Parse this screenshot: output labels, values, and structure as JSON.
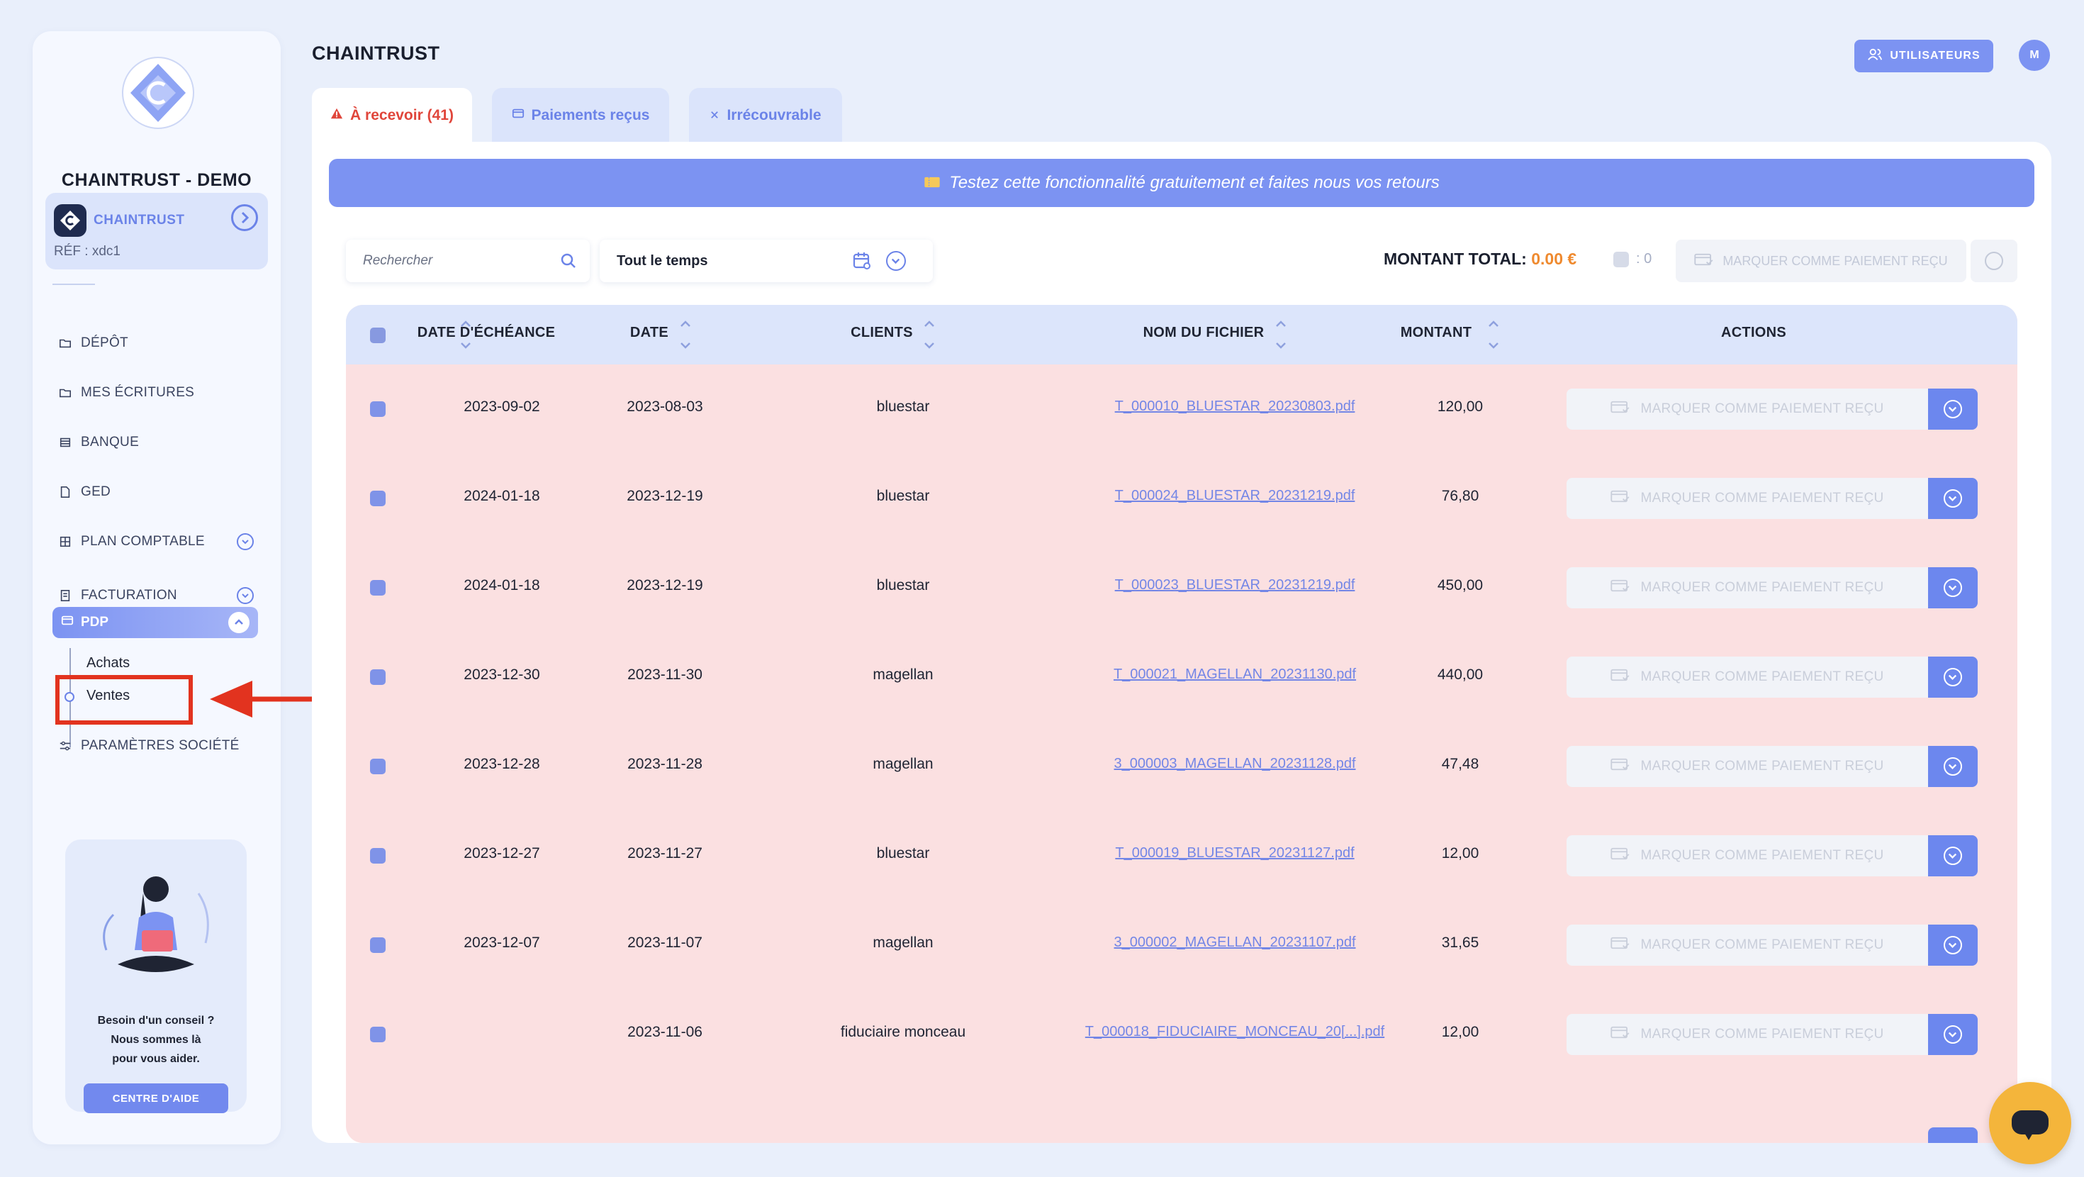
{
  "sidebar": {
    "company_name": "CHAINTRUST - DEMO",
    "org": {
      "name": "CHAINTRUST",
      "ref": "RÉF : xdc1"
    },
    "nav": [
      {
        "label": "DÉPÔT",
        "icon": "folder-icon"
      },
      {
        "label": "MES ÉCRITURES",
        "icon": "folder-icon"
      },
      {
        "label": "BANQUE",
        "icon": "bank-icon"
      },
      {
        "label": "GED",
        "icon": "document-icon"
      },
      {
        "label": "PLAN COMPTABLE",
        "icon": "grid-icon",
        "expandable": true
      },
      {
        "label": "FACTURATION",
        "icon": "invoice-icon",
        "expandable": true
      }
    ],
    "pdp": {
      "label": "PDP",
      "expanded": true,
      "sub": [
        "Achats",
        "Ventes"
      ],
      "active_sub": "Ventes"
    },
    "settings_label": "PARAMÈTRES SOCIÉTÉ",
    "help": {
      "line1": "Besoin d'un conseil ?",
      "line2": "Nous sommes là",
      "line3": "pour vous aider.",
      "button": "CENTRE D'AIDE"
    }
  },
  "header": {
    "title": "CHAINTRUST",
    "users_button": "UTILISATEURS",
    "avatar_initial": "M"
  },
  "tabs": [
    {
      "label": "À recevoir (41)",
      "icon": "warning-icon",
      "active": true
    },
    {
      "label": "Paiements reçus",
      "icon": "card-icon",
      "active": false
    },
    {
      "label": "Irrécouvrable",
      "icon": "close-icon",
      "active": false
    }
  ],
  "banner": {
    "text": "Testez cette fonctionnalité gratuitement et faites nous vos retours",
    "icon": "ticket-icon"
  },
  "toolbar": {
    "search_placeholder": "Rechercher",
    "period": "Tout le temps",
    "total_label": "MONTANT TOTAL:",
    "total_value": "0.00 €",
    "selected_count": ": 0",
    "bulk_button": "MARQUER COMME PAIEMENT REÇU"
  },
  "table": {
    "columns": [
      "DATE D'ÉCHÉANCE",
      "DATE",
      "CLIENTS",
      "NOM DU FICHIER",
      "MONTANT",
      "ACTIONS"
    ],
    "action_label": "MARQUER COMME PAIEMENT REÇU",
    "rows": [
      {
        "due": "2023-09-02",
        "date": "2023-08-03",
        "client": "bluestar",
        "file": "T_000010_BLUESTAR_20230803.pdf",
        "amount": "120,00"
      },
      {
        "due": "2024-01-18",
        "date": "2023-12-19",
        "client": "bluestar",
        "file": "T_000024_BLUESTAR_20231219.pdf",
        "amount": "76,80"
      },
      {
        "due": "2024-01-18",
        "date": "2023-12-19",
        "client": "bluestar",
        "file": "T_000023_BLUESTAR_20231219.pdf",
        "amount": "450,00"
      },
      {
        "due": "2023-12-30",
        "date": "2023-11-30",
        "client": "magellan",
        "file": "T_000021_MAGELLAN_20231130.pdf",
        "amount": "440,00"
      },
      {
        "due": "2023-12-28",
        "date": "2023-11-28",
        "client": "magellan",
        "file": "3_000003_MAGELLAN_20231128.pdf",
        "amount": "47,48"
      },
      {
        "due": "2023-12-27",
        "date": "2023-11-27",
        "client": "bluestar",
        "file": "T_000019_BLUESTAR_20231127.pdf",
        "amount": "12,00"
      },
      {
        "due": "2023-12-07",
        "date": "2023-11-07",
        "client": "magellan",
        "file": "3_000002_MAGELLAN_20231107.pdf",
        "amount": "31,65"
      },
      {
        "due": "",
        "date": "2023-11-06",
        "client": "fiduciaire monceau",
        "file": "T_000018_FIDUCIAIRE_MONCEAU_20[...].pdf",
        "amount": "12,00"
      }
    ]
  },
  "colors": {
    "accent": "#7c93f2",
    "row_bg": "#fbe0e1",
    "alert": "#e0463b",
    "total": "#ef8a2f",
    "annotation": "#e2331f"
  }
}
